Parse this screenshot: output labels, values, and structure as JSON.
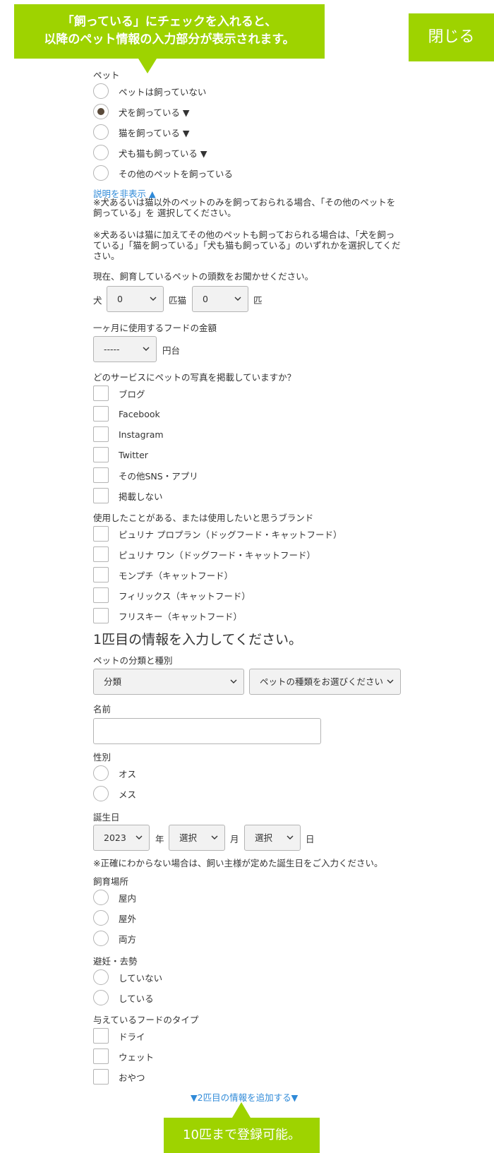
{
  "callout_top": {
    "line1": "「飼っている」にチェックを入れると、",
    "line2": "以降のペット情報の入力部分が表示されます。"
  },
  "close_label": "閉じる",
  "pet": {
    "label": "ペット",
    "options": [
      "ペットは飼っていない",
      "犬を飼っている ▼",
      "猫を飼っている ▼",
      "犬も猫も飼っている ▼",
      "その他のペットを飼っている"
    ],
    "selected_index": 1,
    "hide_desc_link": "説明を非表示 ▲",
    "note1": "※犬あるいは猫以外のペットのみを飼っておられる場合、「その他のペットを飼っている」を 選択してください。",
    "note2": "※犬あるいは猫に加えてその他のペットも飼っておられる場合は、「犬を飼っている」「猫を飼っている」「犬も猫も飼っている」のいずれかを選択してください。"
  },
  "count": {
    "label": "現在、飼育しているペットの頭数をお聞かせください。",
    "dog_prefix": "犬",
    "dog_value": "0",
    "mid_text": "匹猫",
    "cat_value": "0",
    "suffix": "匹"
  },
  "food_cost": {
    "label": "一ヶ月に使用するフードの金額",
    "value": "-----",
    "unit": "円台"
  },
  "photo_services": {
    "label": "どのサービスにペットの写真を掲載していますか？",
    "options": [
      "ブログ",
      "Facebook",
      "Instagram",
      "Twitter",
      "その他SNS・アプリ",
      "掲載しない"
    ]
  },
  "brands": {
    "label": "使用したことがある、または使用したいと思うブランド",
    "options": [
      "ピュリナ プロプラン（ドッグフード・キャットフード）",
      "ピュリナ ワン（ドッグフード・キャットフード）",
      "モンプチ（キャットフード）",
      "フィリックス（キャットフード）",
      "フリスキー（キャットフード）"
    ]
  },
  "pet1": {
    "title": "1匹目の情報を入力してください。",
    "category_label": "ペットの分類と種別",
    "category_value": "分類",
    "type_value": "ペットの種類をお選びください",
    "name_label": "名前",
    "name_value": "",
    "sex_label": "性別",
    "sex_options": [
      "オス",
      "メス"
    ],
    "birthday_label": "誕生日",
    "year_value": "2023",
    "year_unit": "年",
    "month_value": "選択",
    "month_unit": "月",
    "day_value": "選択",
    "day_unit": "日",
    "birthday_note": "※正確にわからない場合は、飼い主様が定めた誕生日をご入力ください。",
    "place_label": "飼育場所",
    "place_options": [
      "屋内",
      "屋外",
      "両方"
    ],
    "neuter_label": "避妊・去勢",
    "neuter_options": [
      "していない",
      "している"
    ],
    "food_type_label": "与えているフードのタイプ",
    "food_type_options": [
      "ドライ",
      "ウェット",
      "おやつ"
    ]
  },
  "add_pet_link": "▼2匹目の情報を追加する▼",
  "callout_bottom": "10匹まで登録可能。",
  "colors": {
    "accent": "#9ed300",
    "link": "#2f8ad8",
    "radio_checked": "#5a4a3a"
  }
}
